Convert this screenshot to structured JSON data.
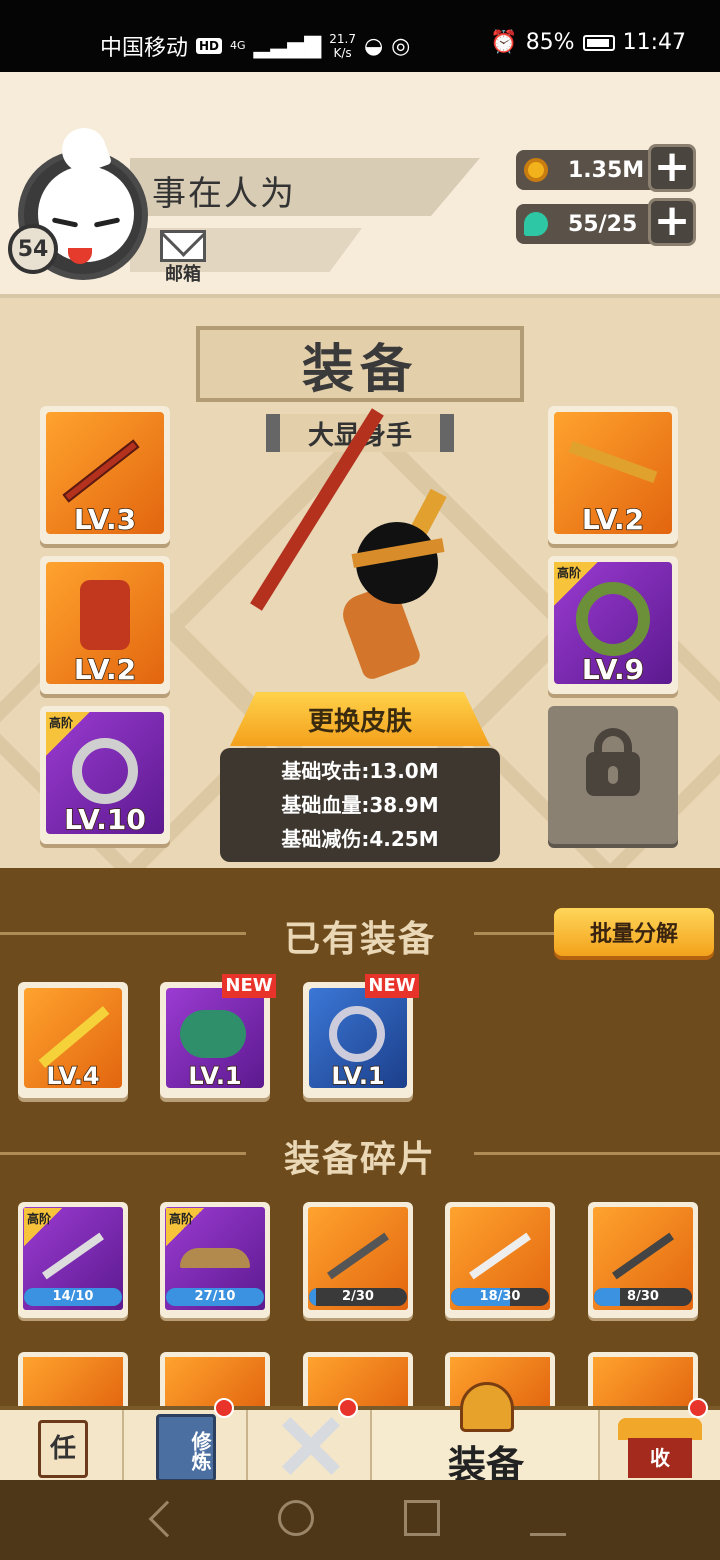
{
  "status_bar": {
    "carrier": "中国移动",
    "hd": "HD",
    "network": "4G",
    "speed_value": "21.7",
    "speed_unit": "K/s",
    "battery": "85%",
    "time": "11:47"
  },
  "player": {
    "name": "事在人为",
    "level": "54",
    "mailbox_label": "邮箱"
  },
  "currencies": {
    "gold": "1.35M",
    "energy": "55/25",
    "add_symbol": "+"
  },
  "equipment": {
    "title": "装备",
    "subtitle": "大显身手",
    "change_skin_label": "更换皮肤",
    "stats": [
      "基础攻击:13.0M",
      "基础血量:38.9M",
      "基础减伤:4.25M"
    ],
    "high_tier_label": "高阶",
    "slots_left": [
      {
        "level": "LV.3",
        "rarity": "orange"
      },
      {
        "level": "LV.2",
        "rarity": "orange"
      },
      {
        "level": "LV.10",
        "rarity": "purple",
        "high_tier": true
      }
    ],
    "slots_right": [
      {
        "level": "LV.2",
        "rarity": "orange"
      },
      {
        "level": "LV.9",
        "rarity": "purple",
        "high_tier": true
      }
    ]
  },
  "owned": {
    "title": "已有装备",
    "batch_button": "批量分解",
    "new_label": "NEW",
    "items": [
      {
        "level": "LV.4",
        "rarity": "orange",
        "is_new": false
      },
      {
        "level": "LV.1",
        "rarity": "purple",
        "is_new": true
      },
      {
        "level": "LV.1",
        "rarity": "blue",
        "is_new": true
      }
    ]
  },
  "fragments": {
    "title": "装备碎片",
    "items": [
      {
        "progress": "14/10",
        "rarity": "purple",
        "high_tier": true,
        "fill": 1.0
      },
      {
        "progress": "27/10",
        "rarity": "purple",
        "high_tier": true,
        "fill": 1.0
      },
      {
        "progress": "2/30",
        "rarity": "orange",
        "high_tier": false,
        "fill": 0.067
      },
      {
        "progress": "18/30",
        "rarity": "orange",
        "high_tier": false,
        "fill": 0.6
      },
      {
        "progress": "8/30",
        "rarity": "orange",
        "high_tier": false,
        "fill": 0.267
      }
    ]
  },
  "tabs": {
    "task_icon_char": "任",
    "cultivate_icon_chars": "修炼",
    "shop_icon_char": "收",
    "active_label": "装备"
  },
  "colors": {
    "accent_gold": "#f4a01c",
    "badge_red": "#e8332a",
    "panel_brown": "#6e4b1c"
  }
}
